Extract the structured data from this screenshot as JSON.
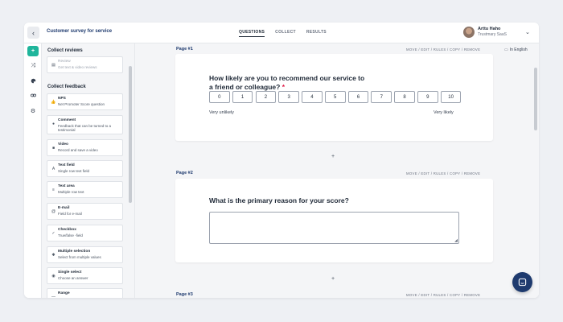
{
  "header": {
    "back_icon": "chevron-left-icon",
    "survey_title": "Customer survey for service",
    "tabs": [
      {
        "label": "QUESTIONS",
        "active": true
      },
      {
        "label": "COLLECT",
        "active": false
      },
      {
        "label": "RESULTS",
        "active": false
      }
    ],
    "user": {
      "name": "Arttu Haho",
      "org": "Trustmary SaaS"
    }
  },
  "rail": {
    "icons": [
      "plus-icon",
      "shuffle-icon",
      "palette-icon",
      "link-icon",
      "gear-icon"
    ],
    "add_glyph": "+"
  },
  "sidebar": {
    "collect_reviews_title": "Collect reviews",
    "review_item": {
      "name": "Review",
      "desc": "Get text & video reviews"
    },
    "collect_feedback_title": "Collect feedback",
    "items": [
      {
        "name": "NPS",
        "desc": "Net Promoter Score question",
        "icon": "thumbs-up-icon"
      },
      {
        "name": "Comment",
        "desc": "Feedback that can be turned to a testimonial",
        "icon": "comment-icon"
      },
      {
        "name": "Video",
        "desc": "Record and save a video",
        "icon": "video-icon"
      },
      {
        "name": "Text field",
        "desc": "Single row text field",
        "icon": "text-icon"
      },
      {
        "name": "Text area",
        "desc": "Multiple row text",
        "icon": "lines-icon"
      },
      {
        "name": "E-mail",
        "desc": "Field for e-mail",
        "icon": "at-icon"
      },
      {
        "name": "Checkbox",
        "desc": "True/false -field",
        "icon": "check-icon"
      },
      {
        "name": "Multiple selection",
        "desc": "Select from multiple values",
        "icon": "multi-select-icon"
      },
      {
        "name": "Single select",
        "desc": "Choose an answer",
        "icon": "radio-icon"
      },
      {
        "name": "Range",
        "desc": "",
        "icon": "range-icon"
      }
    ]
  },
  "canvas": {
    "language": "In English",
    "page_actions": "MOVE / EDIT / RULES / COPY / REMOVE",
    "add_label": "+",
    "pages": [
      {
        "label": "Page #1",
        "question": "How likely are you to recommend our service to a friend or colleague?",
        "required_mark": "*",
        "scale": [
          "0",
          "1",
          "2",
          "3",
          "4",
          "5",
          "6",
          "7",
          "8",
          "9",
          "10"
        ],
        "low_label": "Very unlikely",
        "high_label": "Very likely"
      },
      {
        "label": "Page #2",
        "question": "What is the primary reason for your score?"
      },
      {
        "label": "Page #3"
      }
    ]
  },
  "chat": {
    "icon": "chat-icon"
  },
  "colors": {
    "accent": "#1fb59b",
    "brand": "#1e3a6e",
    "required": "#e11d48"
  }
}
